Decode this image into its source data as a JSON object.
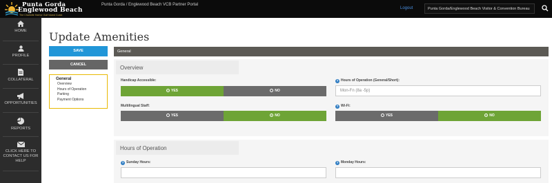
{
  "header": {
    "brand_line1": "Punta Gorda",
    "brand_line2": "Englewood Beach",
    "brand_tagline": "The Charlotte Harbor Gulf Island Coast",
    "portal_title": "Punta Gorda / Englewood Beach VCB Partner Portal",
    "logout_label": "Logout",
    "org_select_value": "Punta Gorda/Englewood Beach Visitor & Convention Bureau",
    "search_icon": "search-icon"
  },
  "sidebar": {
    "items": [
      {
        "label": "HOME",
        "icon": "home-icon"
      },
      {
        "label": "PROFILE",
        "icon": "user-icon"
      },
      {
        "label": "COLLATERAL",
        "icon": "document-icon"
      },
      {
        "label": "OPPORTUNITIES",
        "icon": "megaphone-icon"
      },
      {
        "label": "REPORTS",
        "icon": "pie-chart-icon"
      },
      {
        "label": "CLICK HERE TO CONTACT US FOR HELP",
        "icon": "envelope-icon"
      }
    ]
  },
  "page": {
    "title": "Update Amenities",
    "save_label": "SAVE",
    "cancel_label": "CANCEL"
  },
  "section_nav": {
    "heading": "General",
    "links": [
      "Overview",
      "Hours of Operation",
      "Parking",
      "Payment Options"
    ]
  },
  "main": {
    "section_title": "General",
    "overview": {
      "heading": "Overview",
      "handicap_label": "Handicap Accessible:",
      "handicap_value": "YES",
      "multilingual_label": "Multilingual Staff:",
      "multilingual_value": "NO",
      "hours_short_label": "Hours of Operation (General/Short):",
      "hours_short_value": "Mon-Fn (8a -5p)",
      "wifi_label": "Wi-Fi:",
      "wifi_value": "NO",
      "yes_label": "YES",
      "no_label": "NO"
    },
    "hours": {
      "heading": "Hours of Operation",
      "sunday_label": "Sunday Hours:",
      "sunday_value": "",
      "monday_label": "Monday Hours:",
      "monday_value": ""
    }
  },
  "colors": {
    "accent_blue": "#2196d8",
    "toggle_on": "#6ea436",
    "toggle_off": "#6b6b6b",
    "nav_border": "#e8b800",
    "sidebar_bg": "#2c2c2c"
  }
}
